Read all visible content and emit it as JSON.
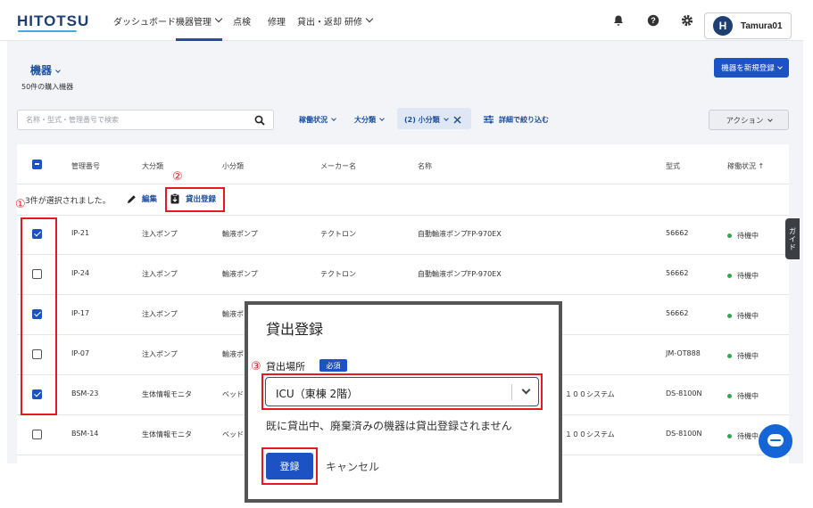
{
  "brand": {
    "logo": "HITOTSU"
  },
  "nav": {
    "items": [
      "ダッシュボード",
      "機器管理",
      "点検",
      "修理",
      "貸出・返却",
      "研修"
    ]
  },
  "header": {
    "user": "Tamura01",
    "avatar_letter": "H"
  },
  "page": {
    "title": "機器",
    "count": "50件の購入機器",
    "new_button": "機器を新規登録"
  },
  "toolbar": {
    "search_placeholder": "名称・型式・管理番号で検索",
    "filters": [
      "稼働状況",
      "大分類",
      "(2) 小分類"
    ],
    "detail_filter": "詳細で絞り込む",
    "action": "アクション"
  },
  "table": {
    "columns": [
      "管理番号",
      "大分類",
      "小分類",
      "メーカー名",
      "名称",
      "型式",
      "稼働状況"
    ],
    "sort_indicator": "↑",
    "selection_text": "3件が選択されました。",
    "edit_label": "編集",
    "lend_label": "貸出登録",
    "rows": [
      {
        "id": "IP-21",
        "major": "注入ポンプ",
        "minor": "輸液ポンプ",
        "maker": "テクトロン",
        "name": "自動輸液ポンプFP-970EX",
        "model": "56662",
        "status": "待機中",
        "checked": true
      },
      {
        "id": "IP-24",
        "major": "注入ポンプ",
        "minor": "輸液ポンプ",
        "maker": "テクトロン",
        "name": "自動輸液ポンプFP-970EX",
        "model": "56662",
        "status": "待機中",
        "checked": false
      },
      {
        "id": "IP-17",
        "major": "注入ポンプ",
        "minor": "輸液ポ",
        "maker": "",
        "name": "",
        "model": "56662",
        "status": "待機中",
        "checked": true
      },
      {
        "id": "IP-07",
        "major": "注入ポンプ",
        "minor": "輸液ポ",
        "maker": "",
        "name": "",
        "model": "JM-OT888",
        "status": "待機中",
        "checked": false
      },
      {
        "id": "BSM-23",
        "major": "生体情報モニタ",
        "minor": "ベッド",
        "maker": "",
        "name": "１００システム",
        "model": "DS-8100N",
        "status": "待機中",
        "checked": true
      },
      {
        "id": "BSM-14",
        "major": "生体情報モニタ",
        "minor": "ベッド",
        "maker": "",
        "name": "１００システム",
        "model": "DS-8100N",
        "status": "待機中",
        "checked": false
      }
    ]
  },
  "guide_tab": "ガイド",
  "annotations": {
    "m1": "①",
    "m2": "②",
    "m3": "③"
  },
  "dialog": {
    "title": "貸出登録",
    "field_label": "貸出場所",
    "required": "必須",
    "selected": "ICU（東棟 2階）",
    "note": "既に貸出中、廃棄済みの機器は貸出登録されません",
    "submit": "登録",
    "cancel": "キャンセル"
  },
  "colors": {
    "primary": "#1d52c4",
    "highlight": "#e8191c",
    "status_ok": "#2fa84f"
  }
}
